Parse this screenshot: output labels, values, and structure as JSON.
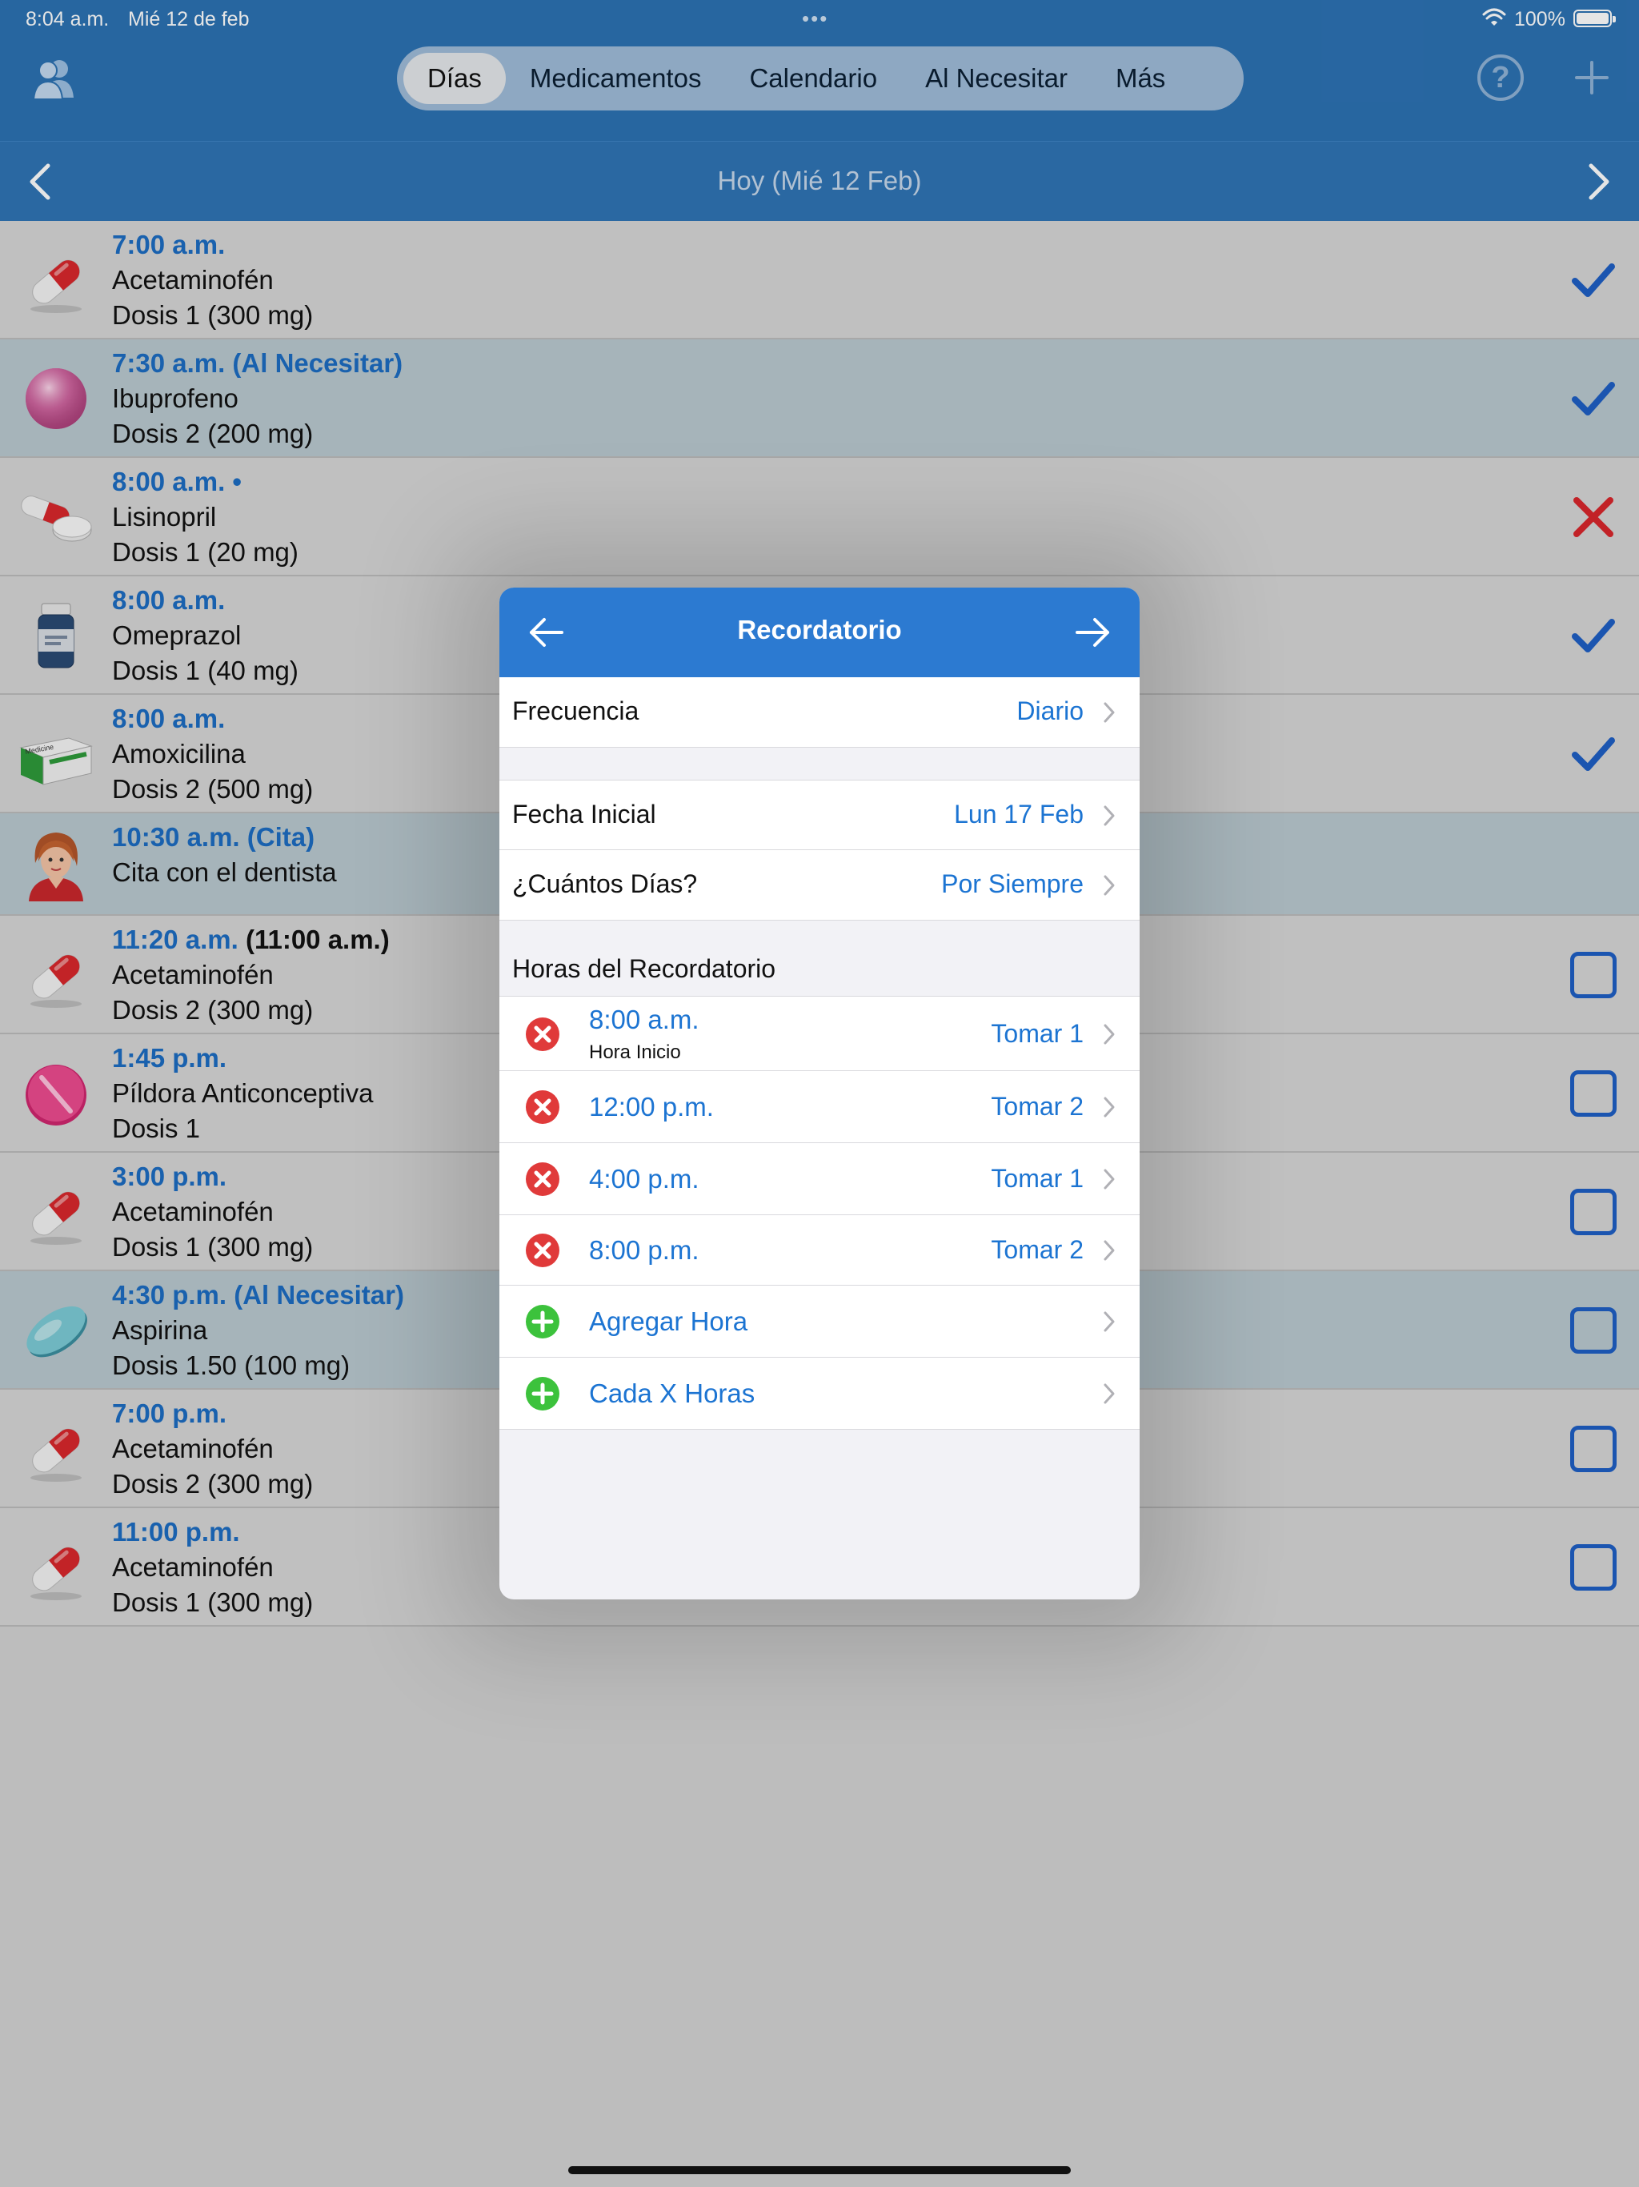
{
  "statusbar": {
    "time": "8:04 a.m.",
    "date": "Mié 12 de feb",
    "dots": "•••",
    "battery": "100%"
  },
  "nav": {
    "tabs": [
      {
        "label": "Días",
        "active": true
      },
      {
        "label": "Medicamentos",
        "active": false
      },
      {
        "label": "Calendario",
        "active": false
      },
      {
        "label": "Al Necesitar",
        "active": false
      },
      {
        "label": "Más",
        "active": false
      }
    ],
    "help": "?"
  },
  "date_nav": {
    "title": "Hoy (Mié 12 Feb)"
  },
  "doses": [
    {
      "time": "7:00 a.m.",
      "time_extra": "",
      "line2": "Acetaminofén",
      "line3": "Dosis 1 (300 mg)",
      "icon": "capsule-red-icon",
      "status": "taken",
      "as_needed": false
    },
    {
      "time": "7:30 a.m. (Al Necesitar)",
      "time_extra": "",
      "line2": "Ibuprofeno",
      "line3": "Dosis 2 (200 mg)",
      "icon": "pink-ball-icon",
      "status": "taken",
      "as_needed": true
    },
    {
      "time": "8:00 a.m. •",
      "time_extra": "",
      "line2": "Lisinopril",
      "line3": "Dosis 1 (20 mg)",
      "icon": "capsule-and-tablet-icon",
      "status": "skipped",
      "as_needed": false
    },
    {
      "time": "8:00 a.m.",
      "time_extra": "",
      "line2": "Omeprazol",
      "line3": "Dosis 1 (40 mg)",
      "icon": "pill-bottle-icon",
      "status": "taken",
      "as_needed": false
    },
    {
      "time": "8:00 a.m.",
      "time_extra": "",
      "line2": "Amoxicilina",
      "line3": "Dosis 2 (500 mg)",
      "icon": "medicine-box-icon",
      "status": "taken",
      "as_needed": false
    },
    {
      "time": "10:30 a.m. (Cita)",
      "time_extra": "",
      "line2": "Cita con el dentista",
      "line3": "",
      "icon": "person-avatar-icon",
      "status": "none",
      "as_needed": true
    },
    {
      "time": "11:20 a.m.",
      "time_extra": " (11:00 a.m.)",
      "line2": "Acetaminofén",
      "line3": "Dosis 2 (300 mg)",
      "icon": "capsule-red-icon",
      "status": "pending",
      "as_needed": false
    },
    {
      "time": "1:45 p.m.",
      "time_extra": "",
      "line2": "Píldora Anticonceptiva",
      "line3": "Dosis 1",
      "icon": "pink-tablet-icon",
      "status": "pending",
      "as_needed": false
    },
    {
      "time": "3:00 p.m.",
      "time_extra": "",
      "line2": "Acetaminofén",
      "line3": "Dosis 1 (300 mg)",
      "icon": "capsule-red-icon",
      "status": "pending",
      "as_needed": false
    },
    {
      "time": "4:30 p.m. (Al Necesitar)",
      "time_extra": "",
      "line2": "Aspirina",
      "line3": "Dosis 1.50 (100 mg)",
      "icon": "teal-tablet-icon",
      "status": "pending",
      "as_needed": true
    },
    {
      "time": "7:00 p.m.",
      "time_extra": "",
      "line2": "Acetaminofén",
      "line3": "Dosis 2 (300 mg)",
      "icon": "capsule-red-icon",
      "status": "pending",
      "as_needed": false
    },
    {
      "time": "11:00 p.m.",
      "time_extra": "",
      "line2": "Acetaminofén",
      "line3": "Dosis 1 (300 mg)",
      "icon": "capsule-red-icon",
      "status": "pending",
      "as_needed": false
    }
  ],
  "modal": {
    "title": "Recordatorio",
    "frequency": {
      "label": "Frecuencia",
      "value": "Diario"
    },
    "start_date": {
      "label": "Fecha Inicial",
      "value": "Lun 17 Feb"
    },
    "how_many_days": {
      "label": "¿Cuántos Días?",
      "value": "Por Siempre"
    },
    "section_title": "Horas del Recordatorio",
    "times": [
      {
        "time": "8:00 a.m.",
        "sub": "Hora Inicio",
        "take": "Tomar 1"
      },
      {
        "time": "12:00 p.m.",
        "sub": "",
        "take": "Tomar 2"
      },
      {
        "time": "4:00 p.m.",
        "sub": "",
        "take": "Tomar 1"
      },
      {
        "time": "8:00 p.m.",
        "sub": "",
        "take": "Tomar 2"
      }
    ],
    "add_time": "Agregar Hora",
    "every_x_hours": "Cada X Horas"
  },
  "colors": {
    "header_blue": "#2c72b3",
    "accent_blue": "#1c74d2",
    "check_blue": "#1f5fc4",
    "skip_red": "#d9262c",
    "remove_red": "#e03a3a",
    "add_green": "#3cc23c"
  }
}
